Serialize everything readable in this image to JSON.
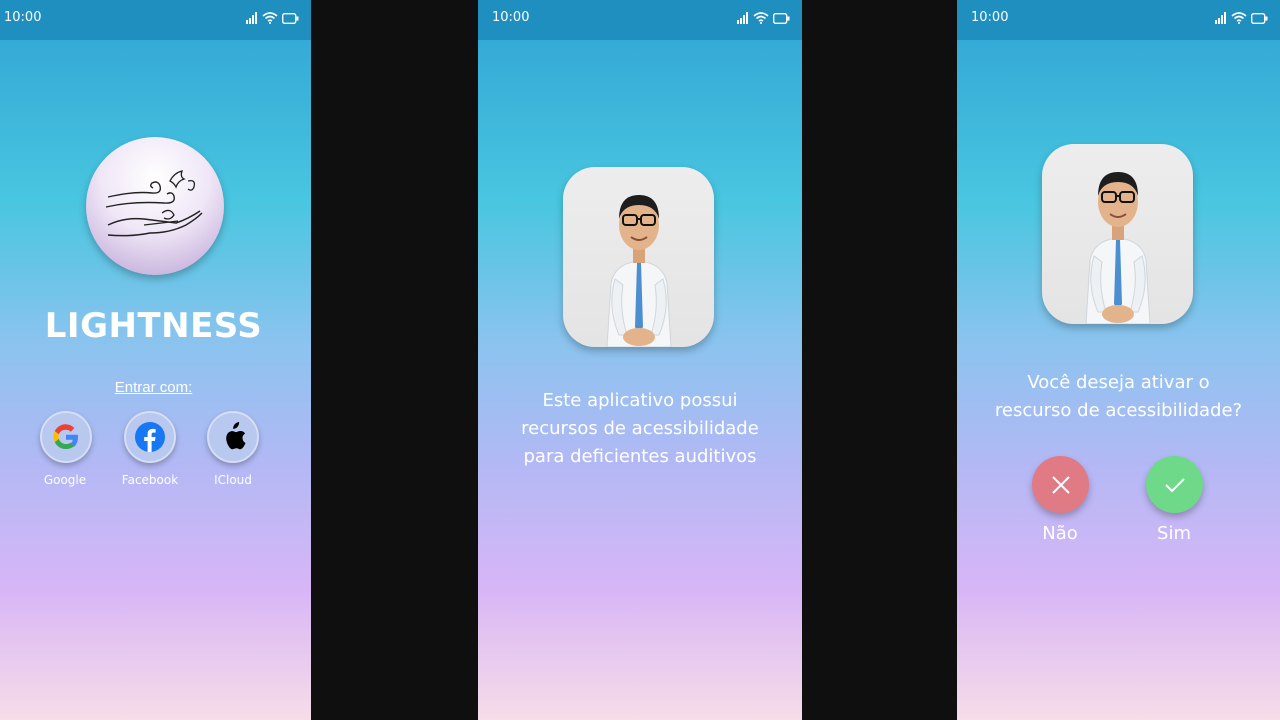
{
  "status_bar": {
    "time": "10:00"
  },
  "login_screen": {
    "app_title": "LIGHTNESS",
    "login_label": "Entrar com:",
    "providers": [
      {
        "label": "Google",
        "icon": "google-icon"
      },
      {
        "label": "Facebook",
        "icon": "facebook-icon"
      },
      {
        "label": "ICloud",
        "icon": "apple-icon"
      }
    ]
  },
  "info_screen": {
    "message_lines": [
      "Este aplicativo possui",
      "recursos de acessibilidade",
      "para deficientes auditivos"
    ]
  },
  "prompt_screen": {
    "question_lines": [
      "Você deseja ativar o",
      "rescurso de acessibilidade?"
    ],
    "no_label": "Não",
    "yes_label": "Sim"
  },
  "colors": {
    "status_bar": "#1f8fc0",
    "no_button": "#e07a85",
    "yes_button": "#6fd98a",
    "facebook_blue": "#1877f2"
  }
}
